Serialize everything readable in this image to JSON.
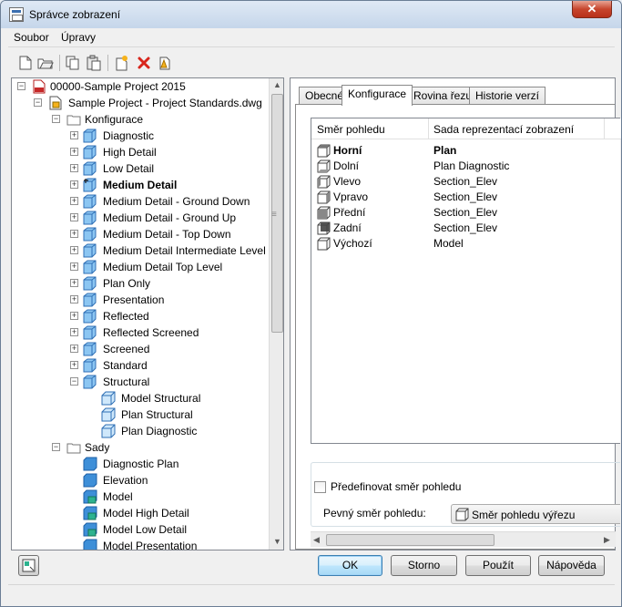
{
  "window": {
    "title": "Správce zobrazení",
    "close_glyph": "✕"
  },
  "menu": {
    "items": [
      "Soubor",
      "Úpravy"
    ]
  },
  "toolbar": {
    "icons": [
      "new-icon",
      "open-icon",
      "copy-icon",
      "paste-icon",
      "new-item-icon",
      "delete-icon",
      "purge-icon"
    ]
  },
  "tree": {
    "root": "00000-Sample Project 2015",
    "drawing": "Sample Project - Project Standards.dwg",
    "configs_folder": "Konfigurace",
    "configs": [
      "Diagnostic",
      "High Detail",
      "Low Detail",
      "Medium Detail",
      "Medium Detail - Ground Down",
      "Medium Detail - Ground Up",
      "Medium Detail - Top Down",
      "Medium Detail Intermediate Level",
      "Medium Detail Top Level",
      "Plan Only",
      "Presentation",
      "Reflected",
      "Reflected Screened",
      "Screened",
      "Standard",
      "Structural"
    ],
    "bold_config": "Medium Detail",
    "structural_children": [
      "Model Structural",
      "Plan Structural",
      "Plan Diagnostic"
    ],
    "sets_folder": "Sady",
    "sets": [
      "Diagnostic Plan",
      "Elevation",
      "Model",
      "Model High Detail",
      "Model Low Detail",
      "Model Presentation"
    ]
  },
  "tabs": [
    "Obecné",
    "Konfigurace",
    "Rovina řezu",
    "Historie verzí"
  ],
  "active_tab": "Konfigurace",
  "view_table": {
    "headers": [
      "Směr pohledu",
      "Sada reprezentací zobrazení"
    ],
    "rows": [
      {
        "direction": "Horní",
        "set": "Plan",
        "bold": true
      },
      {
        "direction": "Dolní",
        "set": "Plan Diagnostic"
      },
      {
        "direction": "Vlevo",
        "set": "Section_Elev"
      },
      {
        "direction": "Vpravo",
        "set": "Section_Elev"
      },
      {
        "direction": "Přední",
        "set": "Section_Elev"
      },
      {
        "direction": "Zadní",
        "set": "Section_Elev"
      },
      {
        "direction": "Výchozí",
        "set": "Model"
      }
    ]
  },
  "override": {
    "checkbox_label": "Předefinovat směr pohledu",
    "checked": false,
    "fixed_label": "Pevný směr pohledu:",
    "fixed_value": "Směr pohledu výřezu"
  },
  "buttons": {
    "ok": "OK",
    "cancel": "Storno",
    "apply": "Použít",
    "help": "Nápověda"
  },
  "colors": {
    "accent": "#3c7fb1",
    "icon_blue": "#3e8fd8",
    "delete_red": "#d8261c"
  }
}
